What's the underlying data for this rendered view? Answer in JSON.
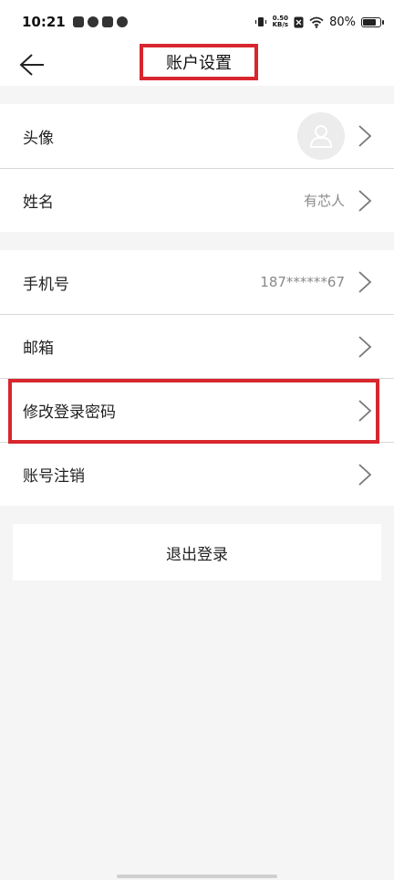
{
  "status_bar": {
    "time": "10:21",
    "net_speed_value": "0.50",
    "net_speed_unit": "KB/s",
    "battery_text": "80%",
    "battery_level": 0.8
  },
  "header": {
    "title": "账户设置"
  },
  "profile": {
    "avatar_label": "头像",
    "name_label": "姓名",
    "name_value": "有芯人"
  },
  "account": {
    "phone_label": "手机号",
    "phone_value": "187******67",
    "email_label": "邮箱",
    "change_password_label": "修改登录密码",
    "cancel_account_label": "账号注销"
  },
  "logout": {
    "label": "退出登录"
  },
  "colors": {
    "highlight": "#d8262f",
    "background": "#f5f5f5",
    "value_text": "#8a8a8a"
  }
}
